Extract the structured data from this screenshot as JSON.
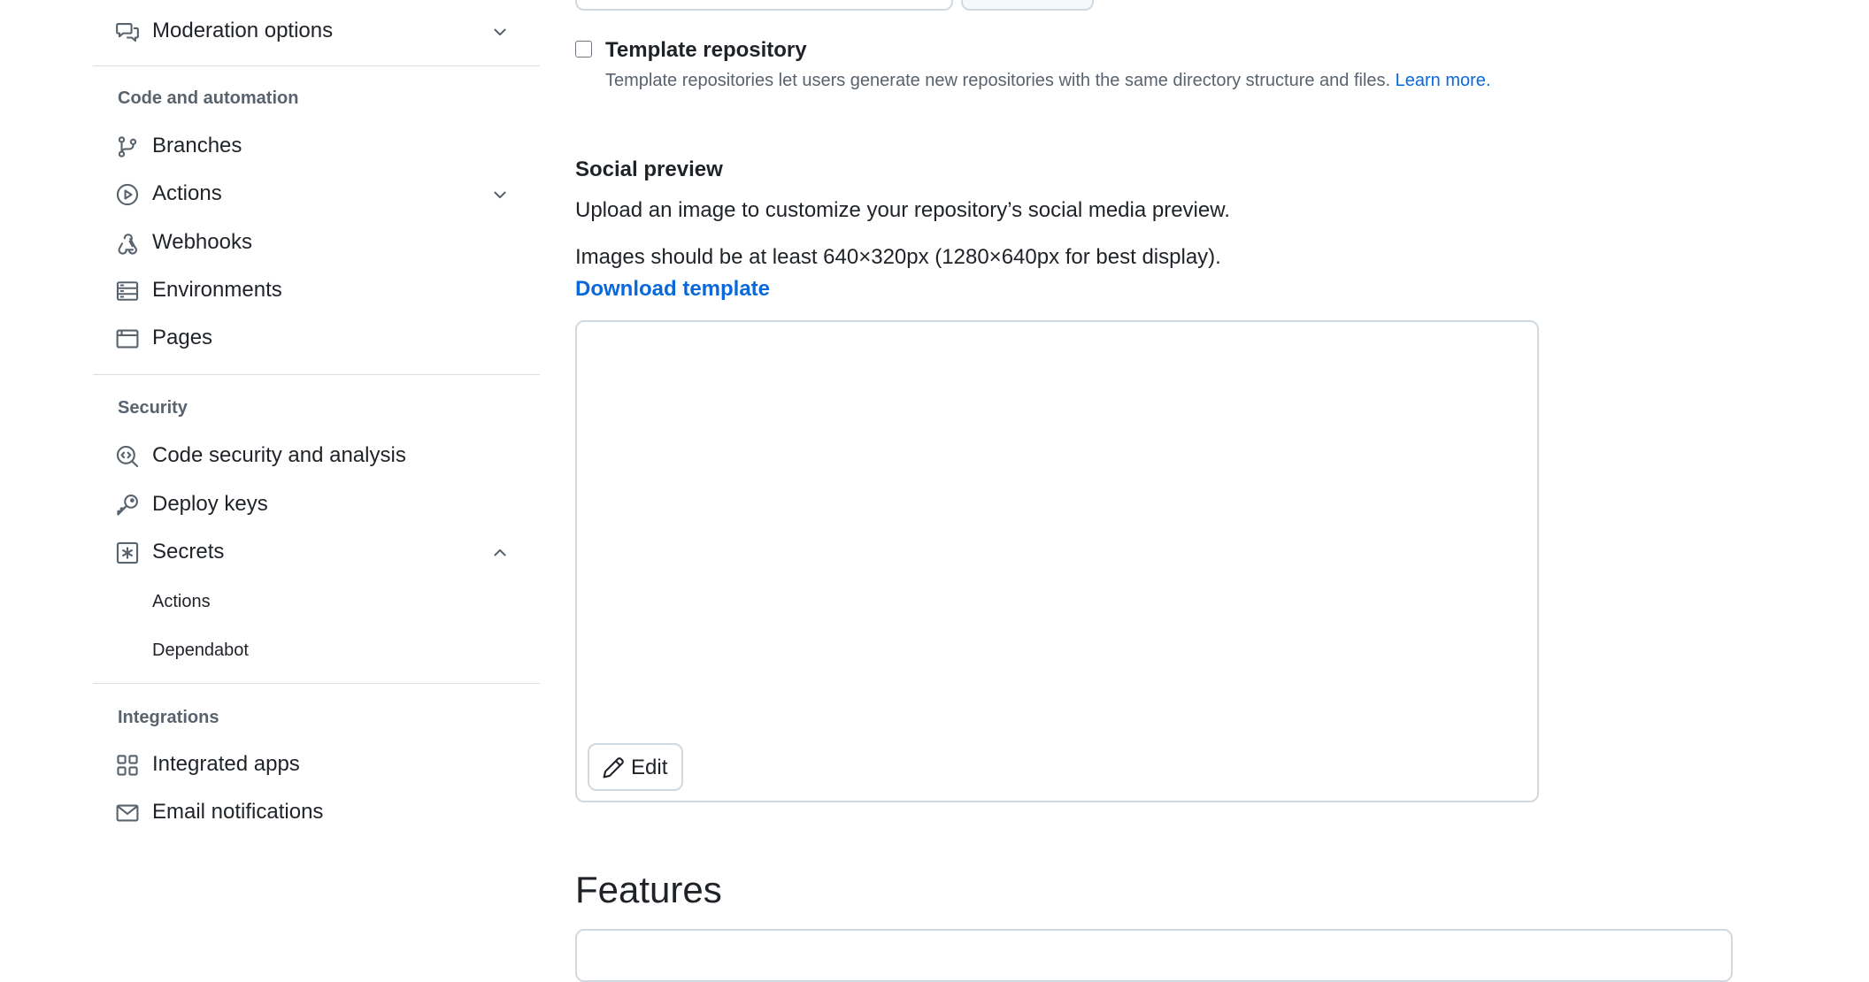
{
  "sidebar": {
    "moderation": {
      "label": "Moderation options",
      "icon": "comment-discussion-icon",
      "expanded": false
    },
    "code_automation": {
      "heading": "Code and automation",
      "items": [
        {
          "label": "Branches",
          "icon": "git-branch-icon"
        },
        {
          "label": "Actions",
          "icon": "play-icon",
          "expanded": false
        },
        {
          "label": "Webhooks",
          "icon": "webhook-icon"
        },
        {
          "label": "Environments",
          "icon": "server-icon"
        },
        {
          "label": "Pages",
          "icon": "browser-icon"
        }
      ]
    },
    "security": {
      "heading": "Security",
      "items": [
        {
          "label": "Code security and analysis",
          "icon": "codescan-icon"
        },
        {
          "label": "Deploy keys",
          "icon": "key-icon"
        },
        {
          "label": "Secrets",
          "icon": "asterisk-icon",
          "expanded": true
        }
      ],
      "secrets_subitems": [
        {
          "label": "Actions"
        },
        {
          "label": "Dependabot"
        }
      ]
    },
    "integrations": {
      "heading": "Integrations",
      "items": [
        {
          "label": "Integrated apps",
          "icon": "apps-icon"
        },
        {
          "label": "Email notifications",
          "icon": "mail-icon"
        }
      ]
    }
  },
  "main": {
    "template_repository": {
      "title": "Template repository",
      "description": "Template repositories let users generate new repositories with the same directory structure and files.",
      "learn_more": "Learn more",
      "checked": false
    },
    "social_preview": {
      "title": "Social preview",
      "description": "Upload an image to customize your repository’s social media preview.",
      "size_hint": "Images should be at least 640×320px (1280×640px for best display).",
      "download_link": "Download template",
      "edit_label": "Edit",
      "edit_icon": "pencil-icon"
    },
    "features": {
      "title": "Features"
    }
  },
  "colors": {
    "text": "#1f2328",
    "muted": "#59636e",
    "link": "#0969da",
    "border": "#d1d9e0"
  }
}
